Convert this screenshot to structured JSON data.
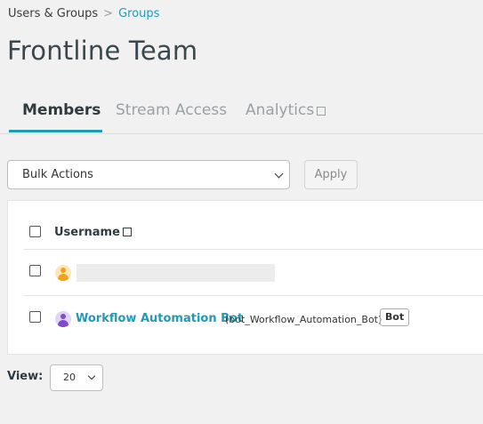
{
  "breadcrumb": {
    "parent": "Users & Groups",
    "separator": ">",
    "current": "Groups"
  },
  "page": {
    "title": "Frontline Team"
  },
  "tabs": [
    {
      "label": "Members",
      "active": true
    },
    {
      "label": "Stream Access",
      "active": false
    },
    {
      "label": "Analytics",
      "active": false
    }
  ],
  "bulk": {
    "selected": "Bulk Actions",
    "apply_label": "Apply"
  },
  "table": {
    "column_username": "Username",
    "rows": [
      {
        "name": "",
        "username": "",
        "badge": "",
        "avatar_color": "#f0a21c"
      },
      {
        "name": "Workflow Automation Bot",
        "username": "(bot_Workflow_Automation_Bot)",
        "badge": "Bot",
        "avatar_color": "#7e4bc9"
      }
    ]
  },
  "pager": {
    "view_label": "View:",
    "view_value": "20"
  },
  "colors": {
    "accent": "#1f9bb5",
    "page_bg": "#f1f1f1"
  }
}
